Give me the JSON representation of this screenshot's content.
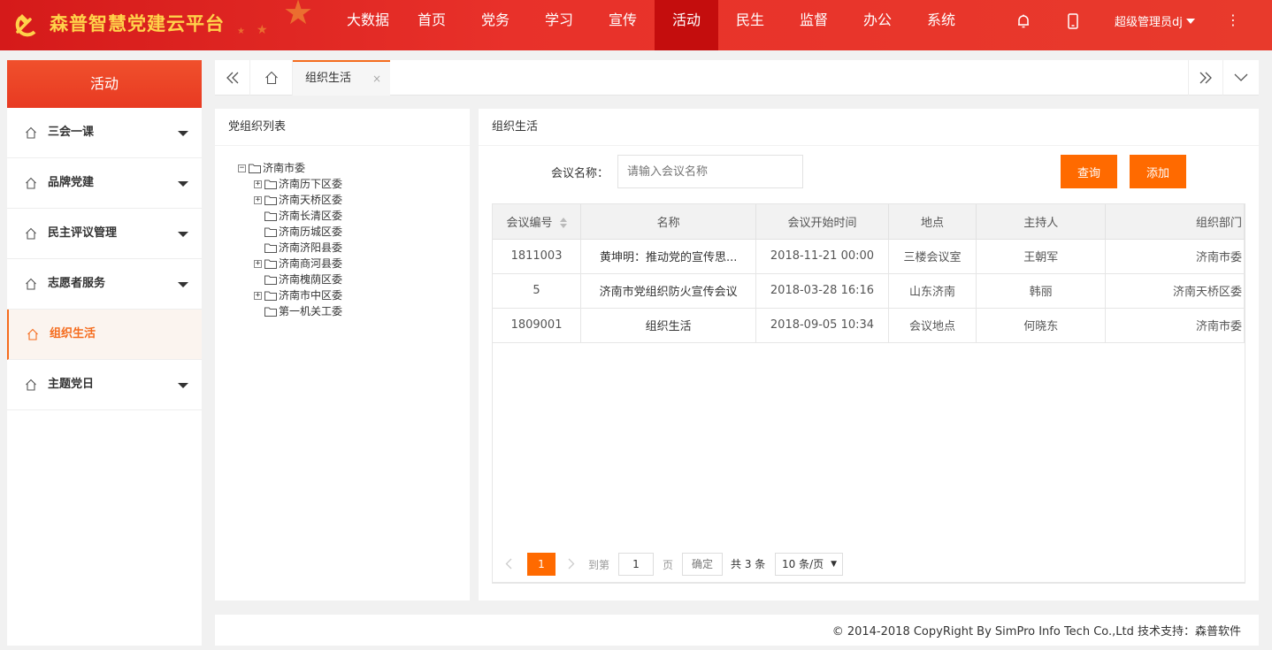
{
  "header": {
    "title": "森普智慧党建云平台",
    "nav": [
      "大数据",
      "首页",
      "党务",
      "学习",
      "宣传",
      "活动",
      "民生",
      "监督",
      "办公",
      "系统"
    ],
    "active_nav": "活动",
    "user": "超级管理员dj",
    "icons": [
      "bell-icon",
      "mobile-icon",
      "more-icon"
    ]
  },
  "sidebar": {
    "heading": "活动",
    "items": [
      {
        "label": "三会一课",
        "expandable": true
      },
      {
        "label": "品牌党建",
        "expandable": true
      },
      {
        "label": "民主评议管理",
        "expandable": true
      },
      {
        "label": "志愿者服务",
        "expandable": true
      },
      {
        "label": "组织生活",
        "expandable": false,
        "active": true
      },
      {
        "label": "主题党日",
        "expandable": true
      }
    ]
  },
  "tabs": {
    "active_tab": "组织生活",
    "close": "×"
  },
  "tree_panel": {
    "title": "党组织列表",
    "root": "济南市委",
    "root_toggle": "−",
    "nodes": [
      {
        "label": "济南历下区委",
        "toggle": "+"
      },
      {
        "label": "济南天桥区委",
        "toggle": "+"
      },
      {
        "label": "济南长清区委",
        "toggle": ""
      },
      {
        "label": "济南历城区委",
        "toggle": ""
      },
      {
        "label": "济南济阳县委",
        "toggle": ""
      },
      {
        "label": "济南商河县委",
        "toggle": "+"
      },
      {
        "label": "济南槐荫区委",
        "toggle": ""
      },
      {
        "label": "济南市中区委",
        "toggle": "+"
      },
      {
        "label": "第一机关工委",
        "toggle": ""
      }
    ]
  },
  "main_panel": {
    "title": "组织生活",
    "search_label": "会议名称：",
    "search_placeholder": "请输入会议名称",
    "query_button": "查询",
    "add_button": "添加"
  },
  "table": {
    "columns": [
      "会议编号",
      "名称",
      "会议开始时间",
      "地点",
      "主持人",
      "组织部门"
    ],
    "rows": [
      [
        "1811003",
        "黄坤明：推动党的宣传思...",
        "2018-11-21 00:00",
        "三楼会议室",
        "王朝军",
        "济南市委"
      ],
      [
        "5",
        "济南市党组织防火宣传会议",
        "2018-03-28 16:16",
        "山东济南",
        "韩丽",
        "济南天桥区委"
      ],
      [
        "1809001",
        "组织生活",
        "2018-09-05 10:34",
        "会议地点",
        "何晓东",
        "济南市委"
      ]
    ]
  },
  "pager": {
    "current": "1",
    "goto_label": "到第",
    "page_input": "1",
    "page_suffix": "页",
    "confirm": "确定",
    "total": "共 3 条",
    "page_size": "10 条/页"
  },
  "footer": {
    "text": "© 2014-2018 CopyRight By SimPro Info Tech Co.,Ltd 技术支持：森普软件"
  },
  "colors": {
    "header_red": "#e8312a",
    "active_nav_red": "#c40d0d",
    "accent_orange": "#ff6a00",
    "title_gold": "#ffd24a"
  }
}
